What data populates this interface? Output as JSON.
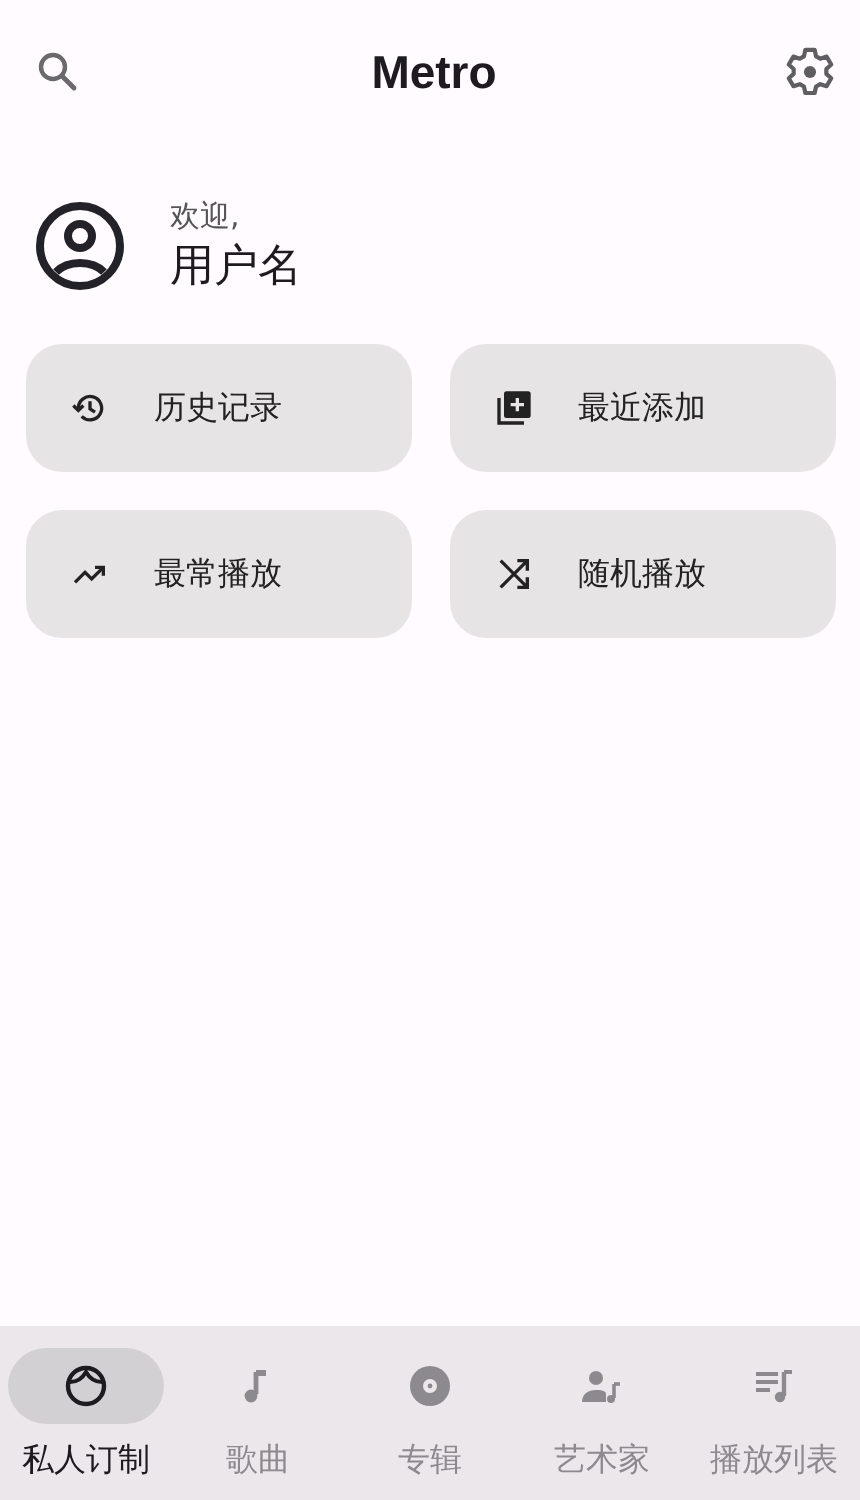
{
  "app_bar": {
    "title": "Metro"
  },
  "greeting": {
    "welcome": "欢迎,",
    "username": "用户名"
  },
  "shortcuts": [
    {
      "kind": "history",
      "label": "历史记录"
    },
    {
      "kind": "recent",
      "label": "最近添加"
    },
    {
      "kind": "top",
      "label": "最常播放"
    },
    {
      "kind": "shuffle",
      "label": "随机播放"
    }
  ],
  "nav": [
    {
      "kind": "face",
      "label": "私人订制",
      "selected": true
    },
    {
      "kind": "song",
      "label": "歌曲",
      "selected": false
    },
    {
      "kind": "album",
      "label": "专辑",
      "selected": false
    },
    {
      "kind": "artist",
      "label": "艺术家",
      "selected": false
    },
    {
      "kind": "playlist",
      "label": "播放列表",
      "selected": false
    }
  ]
}
